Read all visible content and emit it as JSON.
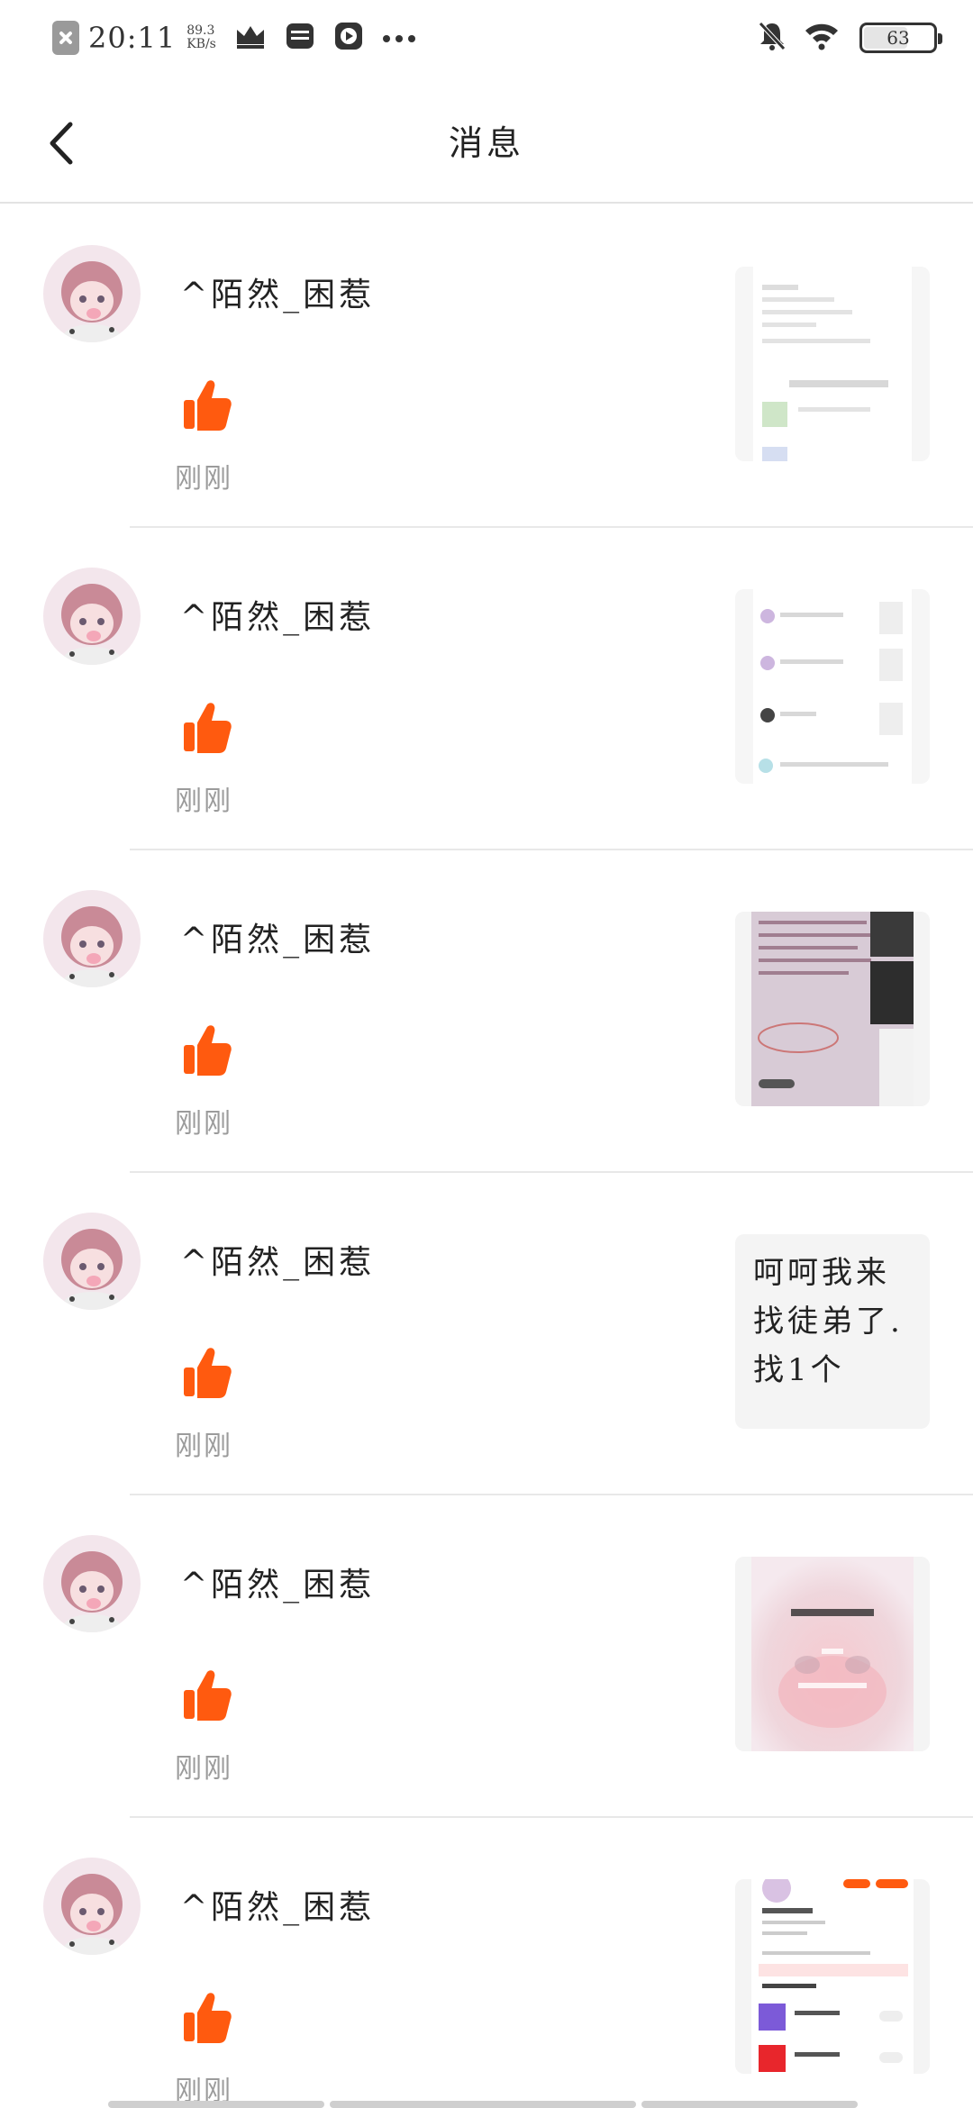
{
  "status_bar": {
    "time": "20:11",
    "speed_value": "89.3",
    "speed_unit": "KB/s",
    "battery": "63",
    "icons": [
      "close-app-icon",
      "crown-icon",
      "wallet-icon",
      "play-icon",
      "more-dots-icon",
      "mute-bell-icon",
      "wifi-icon",
      "battery-icon"
    ]
  },
  "header": {
    "title": "消息",
    "back_icon": "chevron-left-icon"
  },
  "colors": {
    "like_orange": "#ff5a0f",
    "time_gray": "#9b9b9b",
    "thumb_bg": "#f4f4f4"
  },
  "messages": [
    {
      "user": "^陌然_困惹",
      "action_icon": "thumbs-up-icon",
      "time": "刚刚",
      "thumb_type": "image",
      "thumb_text": ""
    },
    {
      "user": "^陌然_困惹",
      "action_icon": "thumbs-up-icon",
      "time": "刚刚",
      "thumb_type": "image",
      "thumb_text": ""
    },
    {
      "user": "^陌然_困惹",
      "action_icon": "thumbs-up-icon",
      "time": "刚刚",
      "thumb_type": "image",
      "thumb_text": ""
    },
    {
      "user": "^陌然_困惹",
      "action_icon": "thumbs-up-icon",
      "time": "刚刚",
      "thumb_type": "text",
      "thumb_text": "呵呵我来找徒弟了.找1个"
    },
    {
      "user": "^陌然_困惹",
      "action_icon": "thumbs-up-icon",
      "time": "刚刚",
      "thumb_type": "image",
      "thumb_text": ""
    },
    {
      "user": "^陌然_困惹",
      "action_icon": "thumbs-up-icon",
      "time": "刚刚",
      "thumb_type": "image",
      "thumb_text": ""
    }
  ]
}
